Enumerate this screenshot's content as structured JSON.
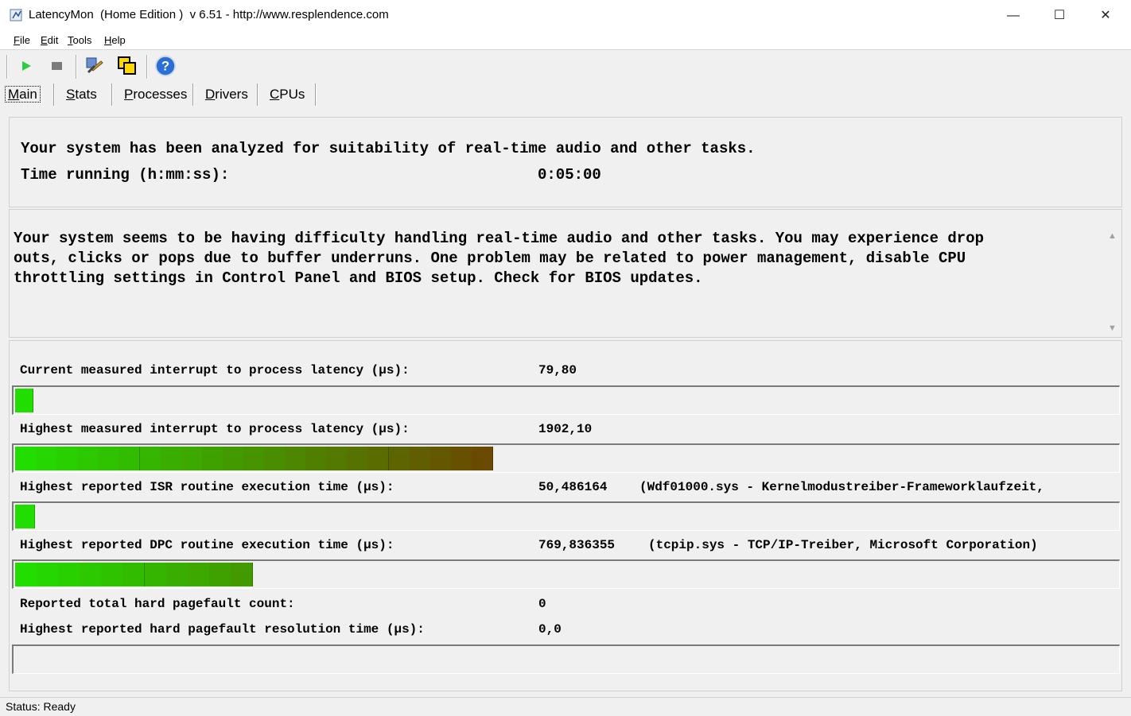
{
  "window": {
    "title": "LatencyMon  (Home Edition )  v 6.51 - http://www.resplendence.com",
    "minimize": "—",
    "maximize": "☐",
    "close": "✕"
  },
  "menu": [
    {
      "u": "F",
      "rest": "ile"
    },
    {
      "u": "E",
      "rest": "dit"
    },
    {
      "u": "T",
      "rest": "ools"
    },
    {
      "u": "H",
      "rest": "elp"
    }
  ],
  "toolbar": {
    "icons": [
      "play-icon",
      "stop-icon",
      "tools-icon",
      "windows-icon",
      "help-icon"
    ],
    "help_glyph": "?"
  },
  "tabs": [
    {
      "u": "M",
      "rest": "ain",
      "active": true
    },
    {
      "u": "S",
      "rest": "tats",
      "active": false
    },
    {
      "u": "P",
      "rest": "rocesses",
      "active": false
    },
    {
      "u": "D",
      "rest": "rivers",
      "active": false
    },
    {
      "u": "C",
      "rest": "PUs",
      "active": false
    }
  ],
  "summary": {
    "headline": "Your system has been analyzed for suitability of real-time audio and other tasks.",
    "time_label": "Time running (h:mm:ss):",
    "time_value": "0:05:00"
  },
  "verdict": {
    "lines": [
      "Your system seems to be having difficulty handling real-time audio and other tasks. You may experience drop",
      "outs, clicks or pops due to buffer underruns. One problem may be related to power management, disable CPU",
      "throttling settings in Control Panel and BIOS setup. Check for BIOS updates."
    ],
    "scroll_up": "▲",
    "scroll_down": "▼"
  },
  "metrics": [
    {
      "label": "Current measured interrupt to process latency (µs):",
      "value": "79,80",
      "detail": "",
      "fill_fraction": 0.016,
      "segments": 1
    },
    {
      "label": "Highest measured interrupt to process latency (µs):",
      "value": "1902,10",
      "detail": "",
      "fill_fraction": 0.432,
      "segments": 23
    },
    {
      "label": "Highest reported ISR routine execution time (µs):",
      "value": "50,486164",
      "detail": "(Wdf01000.sys - Kernelmodustreiber-Frameworklaufzeit, ",
      "fill_fraction": 0.017,
      "segments": 1
    },
    {
      "label": "Highest reported DPC routine execution time (µs):",
      "value": "769,836355",
      "detail": "(tcpip.sys - TCP/IP-Treiber, Microsoft Corporation)",
      "fill_fraction": 0.215,
      "segments": 11
    }
  ],
  "pagefault": {
    "count_label": "Reported total hard pagefault count:",
    "count_value": "0",
    "time_label": "Highest reported hard pagefault resolution time (µs):",
    "time_value": "0,0",
    "fill_fraction": 0
  },
  "status": "Status: Ready",
  "colors": {
    "bar_green": "#22dd00",
    "bar_brown": "#6a4a00",
    "play": "#2ecc40",
    "stop": "#7a7a7a",
    "help": "#2a6fd6"
  }
}
